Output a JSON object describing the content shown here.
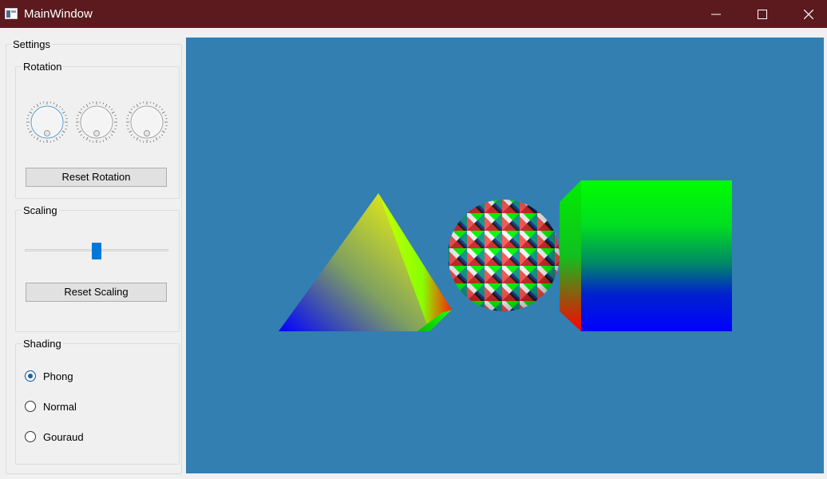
{
  "window": {
    "title": "MainWindow"
  },
  "settings": {
    "title": "Settings",
    "rotation": {
      "title": "Rotation",
      "dials": [
        {
          "name": "rotation-x-dial",
          "value": 0
        },
        {
          "name": "rotation-y-dial",
          "value": 0
        },
        {
          "name": "rotation-z-dial",
          "value": 0
        }
      ],
      "reset_label": "Reset Rotation"
    },
    "scaling": {
      "title": "Scaling",
      "slider_value_fraction": 0.5,
      "reset_label": "Reset Scaling"
    },
    "shading": {
      "title": "Shading",
      "options": [
        {
          "label": "Phong",
          "checked": true
        },
        {
          "label": "Normal",
          "checked": false
        },
        {
          "label": "Gouraud",
          "checked": false
        }
      ]
    }
  },
  "viewport": {
    "background": "#337fb2",
    "objects": [
      "pyramid",
      "sphere",
      "cube"
    ]
  },
  "colors": {
    "titlebar": "#5c1a1e",
    "accent": "#0078d7"
  }
}
